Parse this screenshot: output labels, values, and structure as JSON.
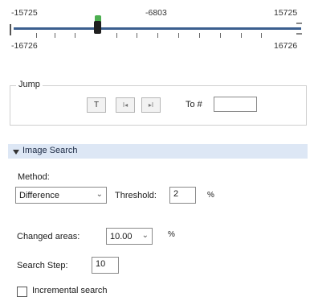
{
  "timeline": {
    "top_left": "-15725",
    "top_center": "-6803",
    "top_right": "15725",
    "bottom_left": "-16726",
    "bottom_right": "16726"
  },
  "jump": {
    "title": "Jump",
    "btn_first": "T",
    "btn_prev": "I◂",
    "btn_next": "▸I",
    "to_label": "To #",
    "to_value": ""
  },
  "image_search": {
    "title": "Image Search",
    "method_label": "Method:",
    "method_value": "Difference",
    "threshold_label": "Threshold:",
    "threshold_value": "2",
    "threshold_unit": "%",
    "changed_areas_label": "Changed areas:",
    "changed_areas_value": "10.00",
    "changed_areas_unit": "%",
    "search_step_label": "Search Step:",
    "search_step_value": "10",
    "incremental_label": "Incremental search",
    "incremental_checked": false
  },
  "colors": {
    "section_header": "#dde7f5",
    "track": "#3b5f8f",
    "thumb_marker": "#4caf50"
  }
}
